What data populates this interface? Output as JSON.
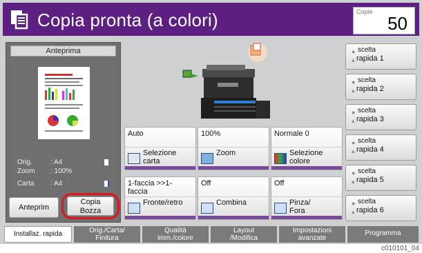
{
  "header": {
    "title": "Copia pronta (a colori)",
    "copies_label": "Copie",
    "copies_value": "50"
  },
  "preview": {
    "header": "Anteprima",
    "orig_label": "Orig.",
    "orig_value": ": A4",
    "zoom_label": "Zoom",
    "zoom_value": ": 100%",
    "carta_label": "Carta",
    "carta_value": ": A4",
    "anteprima_button": "Anteprim",
    "copia_bozza_line1": "Copia",
    "copia_bozza_line2": "Bozza"
  },
  "functions": [
    {
      "value": "Auto",
      "label": "Selezione carta"
    },
    {
      "value": "100%",
      "label": "Zoom"
    },
    {
      "value": "Normale 0",
      "label": "Selezione colore"
    },
    {
      "value": "1-faccia >>1-faccia",
      "label": "Fronte/retro"
    },
    {
      "value": "Off",
      "label": "Combina"
    },
    {
      "value": "Off",
      "label": "Pinza/ Fora"
    }
  ],
  "quick": [
    {
      "top": "scelta",
      "bottom": "rapida 1"
    },
    {
      "top": "scelta",
      "bottom": "rapida 2"
    },
    {
      "top": "scelta",
      "bottom": "rapida 3"
    },
    {
      "top": "scelta",
      "bottom": "rapida 4"
    },
    {
      "top": "scelta",
      "bottom": "rapida 5"
    },
    {
      "top": "scelta",
      "bottom": "rapida 6"
    }
  ],
  "tabs": [
    {
      "line1": "Installaz. rapida",
      "line2": ""
    },
    {
      "line1": "Orig./Carta/",
      "line2": "Finitura"
    },
    {
      "line1": "Qualità",
      "line2": "imm./colore"
    },
    {
      "line1": "Layout",
      "line2": "/Modifica"
    },
    {
      "line1": "Impostazioni",
      "line2": "avanzate"
    },
    {
      "line1": "Programma",
      "line2": ""
    }
  ],
  "footer_code": "c010101_04",
  "colors": {
    "header_bg": "#5d1f82",
    "highlight": "#e0141e",
    "accent": "#7a4a9a"
  }
}
